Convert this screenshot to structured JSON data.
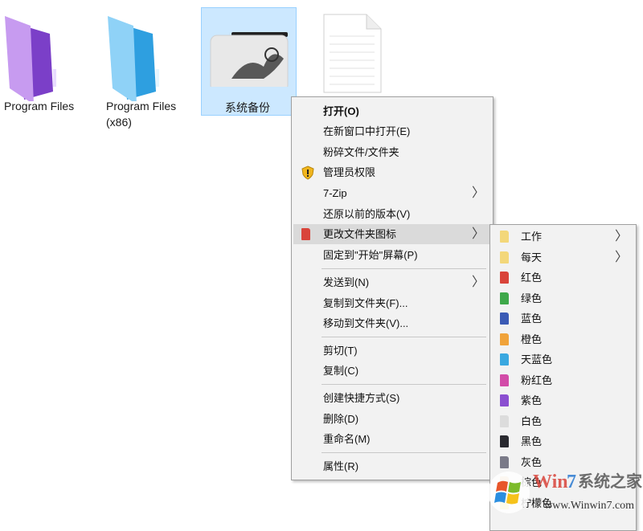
{
  "desktop": {
    "items": [
      {
        "label": "Program Files"
      },
      {
        "label": "Program Files",
        "label2": "(x86)"
      },
      {
        "label": "系统备份",
        "selected": true
      },
      {
        "label": ""
      }
    ]
  },
  "context_menu": {
    "items": [
      {
        "label": "打开(O)",
        "bold": true
      },
      {
        "label": "在新窗口中打开(E)"
      },
      {
        "label": "粉碎文件/文件夹"
      },
      {
        "label": "管理员权限",
        "icon": "shield-icon"
      },
      {
        "label": "7-Zip",
        "submenu": true
      },
      {
        "label": "还原以前的版本(V)"
      },
      {
        "label": "更改文件夹图标",
        "icon": "folder-icon",
        "submenu": true,
        "highlighted": true
      },
      {
        "label": "固定到\"开始\"屏幕(P)"
      },
      {
        "label": "发送到(N)",
        "submenu": true
      },
      {
        "label": "复制到文件夹(F)..."
      },
      {
        "label": "移动到文件夹(V)..."
      },
      {
        "label": "剪切(T)"
      },
      {
        "label": "复制(C)"
      },
      {
        "label": "创建快捷方式(S)"
      },
      {
        "label": "删除(D)"
      },
      {
        "label": "重命名(M)"
      },
      {
        "label": "属性(R)"
      }
    ]
  },
  "submenu": {
    "items": [
      {
        "label": "工作",
        "color": "#f3d77a",
        "submenu": true
      },
      {
        "label": "每天",
        "color": "#f3d77a",
        "submenu": true
      },
      {
        "label": "红色",
        "color": "#d9443a"
      },
      {
        "label": "绿色",
        "color": "#3ea84a"
      },
      {
        "label": "蓝色",
        "color": "#3b5bb5"
      },
      {
        "label": "橙色",
        "color": "#f0a33a"
      },
      {
        "label": "天蓝色",
        "color": "#3aa8e0"
      },
      {
        "label": "粉红色",
        "color": "#d24ca8"
      },
      {
        "label": "紫色",
        "color": "#8b4fd0"
      },
      {
        "label": "白色",
        "color": "#dcdcdc"
      },
      {
        "label": "黑色",
        "color": "#2a2a30"
      },
      {
        "label": "灰色",
        "color": "#7a7a88"
      },
      {
        "label": "棕色",
        "color": "#e8c9a0"
      },
      {
        "label": "柠檬色",
        "color": "#e8e070"
      }
    ]
  },
  "watermark": {
    "brand": "Win7系统之家",
    "url": "www.Winwin7.com"
  }
}
